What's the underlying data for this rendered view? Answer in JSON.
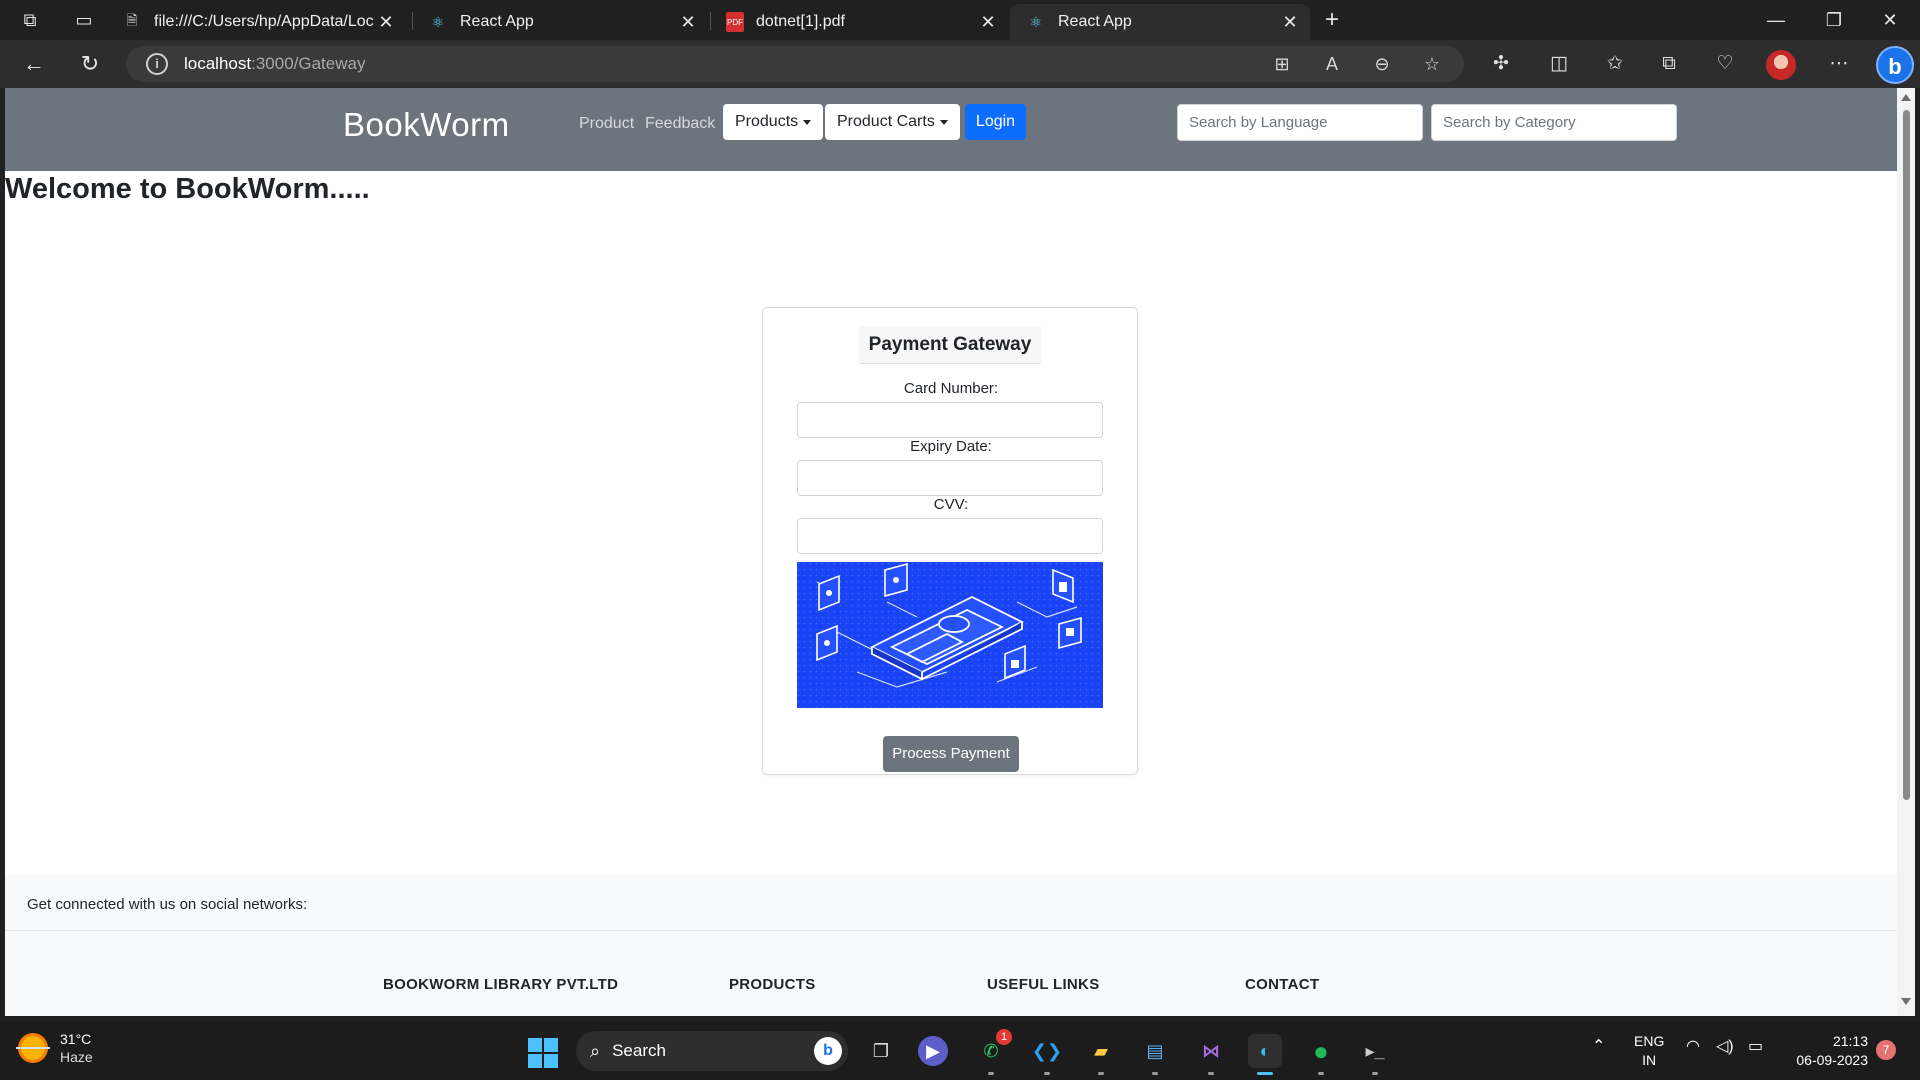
{
  "browser": {
    "tabs": [
      {
        "title": "file:///C:/Users/hp/AppData/Loca",
        "favicon": "pdf-file-icon"
      },
      {
        "title": "React App",
        "favicon": "react-icon"
      },
      {
        "title": "dotnet[1].pdf",
        "favicon": "pdf-icon"
      },
      {
        "title": "React App",
        "favicon": "react-icon"
      }
    ],
    "active_tab": 3,
    "url_host": "localhost",
    "url_path": ":3000/Gateway"
  },
  "navbar": {
    "brand": "BookWorm",
    "links": [
      "Product",
      "Feedback"
    ],
    "dropdowns": [
      "Products",
      "Product Carts"
    ],
    "login_label": "Login",
    "search_language_placeholder": "Search by Language",
    "search_category_placeholder": "Search by Category",
    "bg_color": "#6c757d",
    "login_color": "#0d6efd"
  },
  "main": {
    "welcome": "Welcome to BookWorm.....",
    "payment": {
      "title": "Payment Gateway",
      "card_number_label": "Card Number:",
      "expiry_label": "Expiry Date:",
      "cvv_label": "CVV:",
      "card_number_value": "",
      "expiry_value": "",
      "cvv_value": "",
      "button_label": "Process Payment"
    }
  },
  "footer": {
    "social_text": "Get connected with us on social networks:",
    "columns": [
      "BOOKWORM LIBRARY PVT.LTD",
      "PRODUCTS",
      "USEFUL LINKS",
      "CONTACT"
    ]
  },
  "taskbar": {
    "weather_temp": "31°C",
    "weather_desc": "Haze",
    "search_label": "Search",
    "whatsapp_badge": "1",
    "lang_line1": "ENG",
    "lang_line2": "IN",
    "time": "21:13",
    "date": "06-09-2023",
    "notification_count": "7"
  }
}
